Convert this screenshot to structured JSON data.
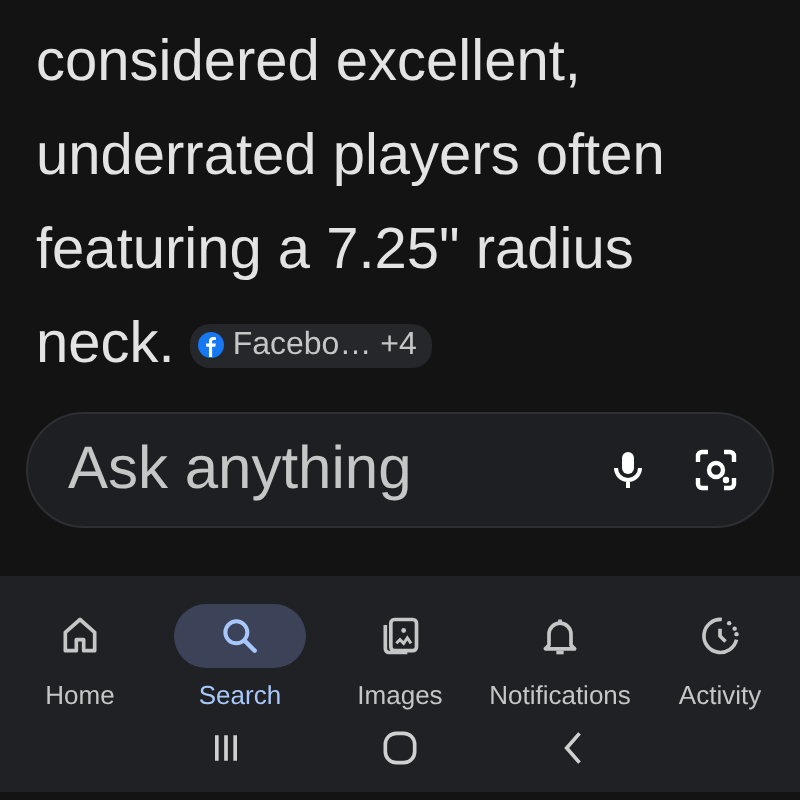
{
  "answer": {
    "lines": [
      "considered excellent,",
      "underrated players often",
      "featuring a 7.25\" radius",
      "neck."
    ],
    "source_chip": {
      "label": "Facebo… +4"
    }
  },
  "search": {
    "placeholder": "Ask anything"
  },
  "nav": [
    {
      "label": "Home",
      "kind": "home",
      "selected": false
    },
    {
      "label": "Search",
      "kind": "search",
      "selected": true
    },
    {
      "label": "Images",
      "kind": "images",
      "selected": false
    },
    {
      "label": "Notifications",
      "kind": "bell",
      "selected": false
    },
    {
      "label": "Activity",
      "kind": "activity",
      "selected": false
    }
  ]
}
